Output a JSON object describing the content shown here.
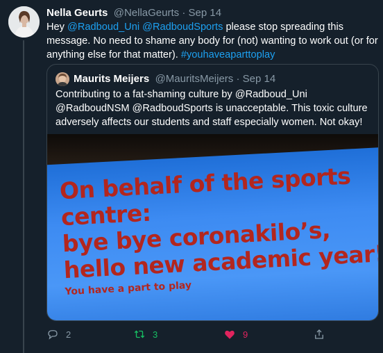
{
  "tweet": {
    "author_name": "Nella Geurts",
    "author_handle": "@NellaGeurts",
    "separator": " · ",
    "date": "Sep 14",
    "text_part1": "Hey ",
    "mention1": "@Radboud_Uni",
    "space": " ",
    "mention2": "@RadboudSports",
    "text_part2": " please stop spreading this message. No need to shame any body for (not) wanting to work out (or for anything else for that matter). ",
    "hashtag": "#youhaveaparttoplay"
  },
  "quoted_tweet": {
    "author_name": "Maurits Meijers",
    "author_handle": "@MauritsMeijers",
    "separator": " · ",
    "date": "Sep 14",
    "text": "Contributing to a fat-shaming culture by @Radboud_Uni @RadboudNSM @RadboudSports is unacceptable. This toxic culture adversely affects our students and staff especially women. Not okay!",
    "image": {
      "line1": "On behalf of the sports",
      "line2": "centre:",
      "line3": "bye bye coronakilo’s,",
      "line4": "hello new academic year!",
      "line5": "You have a part to play"
    }
  },
  "actions": {
    "reply_count": "2",
    "retweet_count": "3",
    "like_count": "9",
    "reply_icon": "reply-icon",
    "retweet_icon": "retweet-icon",
    "like_icon": "heart-icon",
    "share_icon": "share-icon",
    "retweet_color": "#17bf63",
    "like_color": "#e0245e"
  },
  "colors": {
    "background": "#15202b",
    "link": "#1da1f2",
    "muted": "#8899a6",
    "border": "#38444d"
  }
}
